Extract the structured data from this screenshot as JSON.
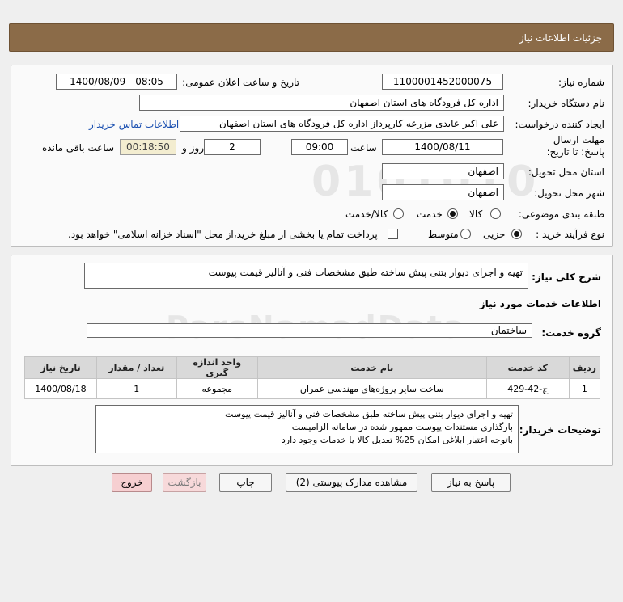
{
  "header": {
    "title": "جزئیات اطلاعات نیاز"
  },
  "form": {
    "need_number_label": "شماره نیاز:",
    "need_number": "1100001452000075",
    "announce_label": "تاریخ و ساعت اعلان عمومی:",
    "announce_value": "1400/08/09 - 08:05",
    "buyer_org_label": "نام دستگاه خریدار:",
    "buyer_org": "اداره کل فرودگاه های استان اصفهان",
    "requester_label": "ایجاد کننده درخواست:",
    "requester": "علی اکبر عابدی مزرعه کارپرداز اداره کل فرودگاه های استان اصفهان",
    "contact_link": "اطلاعات تماس خریدار",
    "deadline_label": "مهلت ارسال پاسخ: تا تاریخ:",
    "deadline_date": "1400/08/11",
    "time_label": "ساعت",
    "deadline_time": "09:00",
    "days_value": "2",
    "days_label": "روز و",
    "remaining_time": "00:18:50",
    "remaining_label": "ساعت باقی مانده",
    "province_label": "استان محل تحویل:",
    "province": "اصفهان",
    "city_label": "شهر محل تحویل:",
    "city": "اصفهان",
    "category_label": "طبقه بندی موضوعی:",
    "category_options": [
      "کالا",
      "خدمت",
      "کالا/خدمت"
    ],
    "category_selected": "خدمت",
    "process_label": "نوع فرآیند خرید :",
    "process_options": [
      "جزیی",
      "متوسط"
    ],
    "process_selected": "جزیی",
    "payment_note": "پرداخت تمام یا بخشی از مبلغ خرید،از محل \"اسناد خزانه اسلامی\" خواهد بود."
  },
  "summary": {
    "label": "شرح کلی نیاز:",
    "text": "تهیه و اجرای دیوار بتنی پیش ساخته طبق مشخصات فنی و آنالیز قیمت پیوست"
  },
  "services": {
    "section_title": "اطلاعات خدمات مورد نیاز",
    "group_label": "گروه خدمت:",
    "group_value": "ساختمان",
    "columns": [
      "ردیف",
      "کد خدمت",
      "نام خدمت",
      "واحد اندازه گیری",
      "تعداد / مقدار",
      "تاریخ نیاز"
    ],
    "rows": [
      [
        "1",
        "ج-42-429",
        "ساخت سایر پروژه‌های مهندسی عمران",
        "مجموعه",
        "1",
        "1400/08/18"
      ]
    ]
  },
  "buyer_notes": {
    "label": "توضیحات خریدار:",
    "text": "تهیه و اجرای دیوار بتنی پیش ساخته طبق مشخصات فنی و آنالیز قیمت پیوست\nبارگذاری مستندات پیوست ممهور شده در سامانه الزامیست\nباتوجه اعتبار ابلاغی امکان 25% تعدیل کالا یا خدمات وجود دارد"
  },
  "buttons": {
    "reply": "پاسخ به نیاز",
    "view_docs": "مشاهده مدارک پیوستی (2)",
    "print": "چاپ",
    "back": "بازگشت",
    "exit": "خروج"
  },
  "watermark": {
    "digits": "0101010",
    "brand": "ParsNamadData"
  }
}
